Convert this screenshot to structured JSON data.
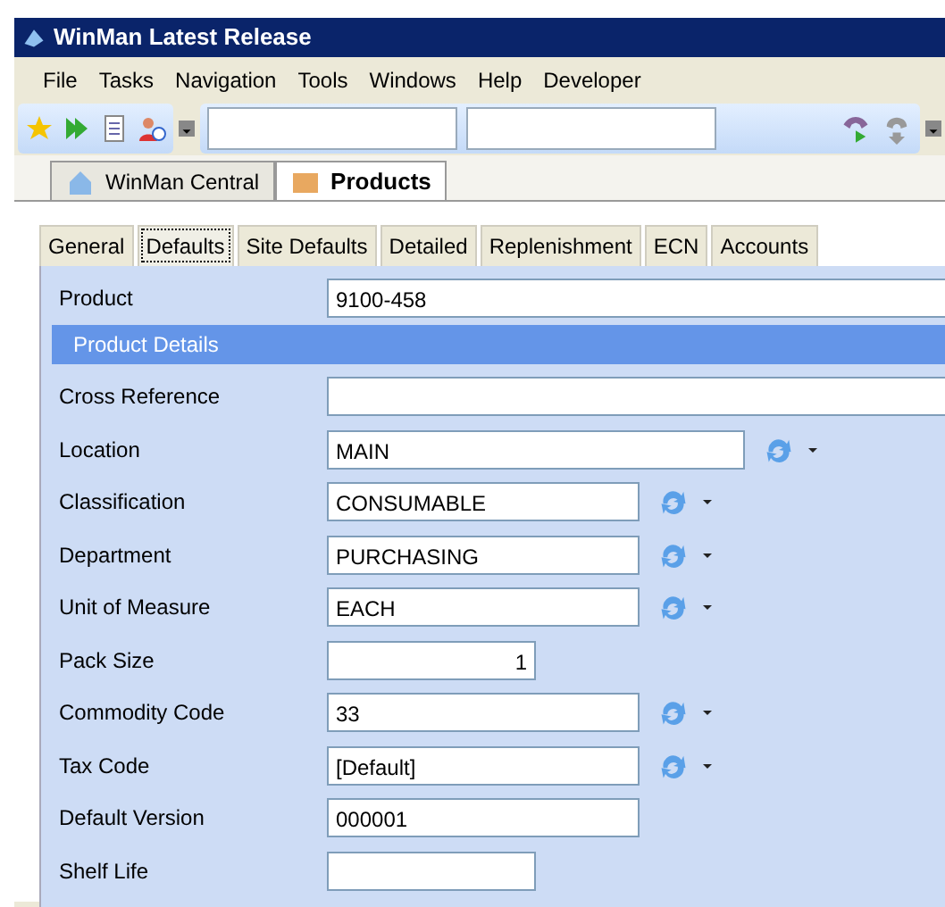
{
  "window": {
    "title": "WinMan Latest Release"
  },
  "menu": [
    "File",
    "Tasks",
    "Navigation",
    "Tools",
    "Windows",
    "Help",
    "Developer"
  ],
  "doc_tabs": [
    {
      "label": "WinMan Central",
      "selected": false
    },
    {
      "label": "Products",
      "selected": true
    }
  ],
  "tabs": [
    {
      "label": "General",
      "selected": false
    },
    {
      "label": "Defaults",
      "selected": true
    },
    {
      "label": "Site Defaults",
      "selected": false
    },
    {
      "label": "Detailed",
      "selected": false
    },
    {
      "label": "Replenishment",
      "selected": false
    },
    {
      "label": "ECN",
      "selected": false
    },
    {
      "label": "Accounts",
      "selected": false
    }
  ],
  "product": {
    "label": "Product",
    "value": "9100-458"
  },
  "section": {
    "title": "Product Details"
  },
  "fields": [
    {
      "label": "Cross Reference",
      "kind": "full"
    },
    {
      "label": "Location",
      "value": "MAIN",
      "kind": "wide-lookup"
    },
    {
      "label": "Classification",
      "value": "CONSUMABLE",
      "kind": "lookup"
    },
    {
      "label": "Department",
      "value": "PURCHASING",
      "kind": "lookup"
    },
    {
      "label": "Unit of Measure",
      "value": "EACH",
      "kind": "lookup"
    },
    {
      "label": "Pack Size",
      "value": "1",
      "kind": "number"
    },
    {
      "label": "Commodity Code",
      "value": "33",
      "kind": "lookup"
    },
    {
      "label": "Tax Code",
      "value": "[Default]",
      "kind": "lookup"
    },
    {
      "label": "Default Version",
      "value": "000001",
      "kind": "medium"
    },
    {
      "label": "Shelf Life",
      "kind": "short"
    }
  ]
}
